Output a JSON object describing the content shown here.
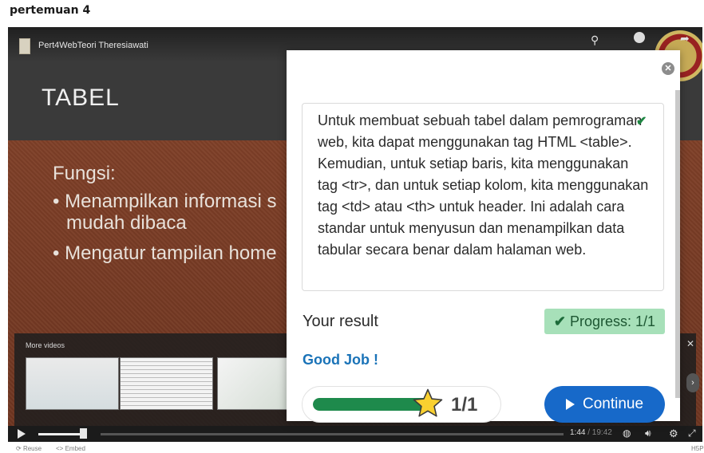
{
  "page": {
    "heading": "pertemuan 4"
  },
  "video": {
    "title": "Pert4WebTeori Theresiawati",
    "slide": {
      "title": "TABEL",
      "subtitle": "Fungsi:",
      "bullets": [
        "Menampilkan informasi s\nmudah dibaca",
        "Mengatur tampilan home"
      ]
    },
    "more_videos": {
      "label": "More videos"
    },
    "controls": {
      "time_current": "1:44",
      "time_total": " / 19:42"
    },
    "footer": {
      "reuse": "Reuse",
      "embed": "<> Embed",
      "h5p": "H5P"
    }
  },
  "dialog": {
    "answer_text": "Untuk membuat sebuah tabel dalam pemrograman web, kita dapat menggunakan tag HTML <table>. Kemudian, untuk setiap baris, kita menggunakan tag <tr>, dan untuk setiap kolom, kita menggunakan tag <td> atau <th> untuk header. Ini adalah cara standar untuk menyusun dan menampilkan data tabular secara benar dalam halaman web.",
    "result_label": "Your result",
    "progress_label": "Progress: 1/1",
    "feedback": "Good Job !",
    "score_text": "1/1",
    "score_fraction": 1.0,
    "continue_label": "Continue",
    "accent_color": "#1769c9",
    "success_color": "#1e8a4c"
  }
}
